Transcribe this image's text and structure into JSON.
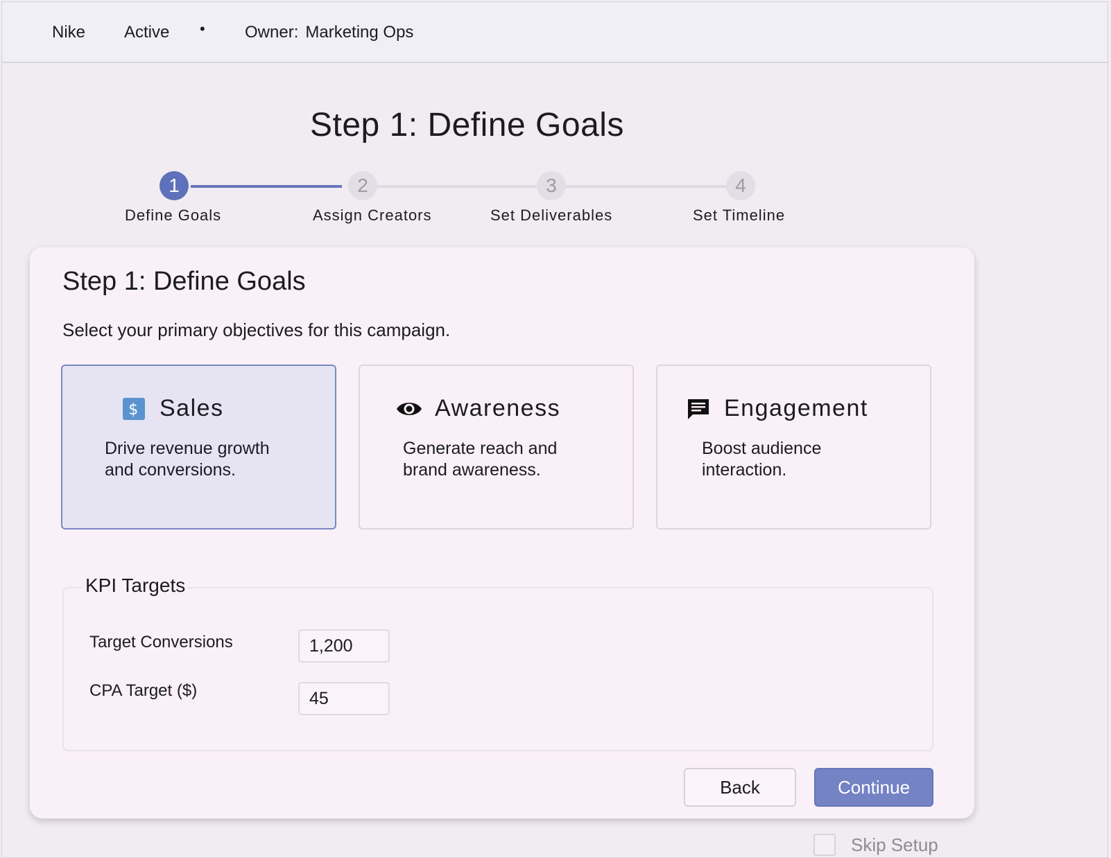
{
  "header": {
    "brand": "Nike",
    "status": "Active",
    "separator": "•",
    "owner_label": "Owner:",
    "owner_value": "Marketing Ops"
  },
  "page_title": "Step 1: Define Goals",
  "stepper": {
    "steps": [
      {
        "number": "1",
        "label": "Define Goals",
        "state": "active"
      },
      {
        "number": "2",
        "label": "Assign Creators",
        "state": "pending"
      },
      {
        "number": "3",
        "label": "Set Deliverables",
        "state": "pending"
      },
      {
        "number": "4",
        "label": "Set Timeline",
        "state": "pending"
      }
    ]
  },
  "card": {
    "title": "Step 1: Define Goals",
    "subtitle": "Select your primary objectives for this campaign.",
    "goals": [
      {
        "title": "Sales",
        "icon": "dollar-icon",
        "description_line1": "Drive revenue growth",
        "description_line2": "and conversions.",
        "selected": true
      },
      {
        "title": "Awareness",
        "icon": "eye-icon",
        "description_line1": "Generate reach and",
        "description_line2": "brand awareness.",
        "selected": false
      },
      {
        "title": "Engagement",
        "icon": "chat-icon",
        "description_line1": "Boost audience",
        "description_line2": "interaction.",
        "selected": false
      }
    ],
    "kpi": {
      "legend": "KPI Targets",
      "target_conversions_label": "Target Conversions",
      "target_conversions_value": "1,200",
      "cpa_target_label": "CPA Target ($)",
      "cpa_target_value": "45"
    },
    "back_label": "Back",
    "continue_label": "Continue"
  },
  "skip_label": "Skip Setup",
  "colors": {
    "accent": "#5f71bb",
    "continue_button": "#7383c4",
    "selected_card": "#e6e4f2",
    "card_background": "#faf0f7"
  }
}
